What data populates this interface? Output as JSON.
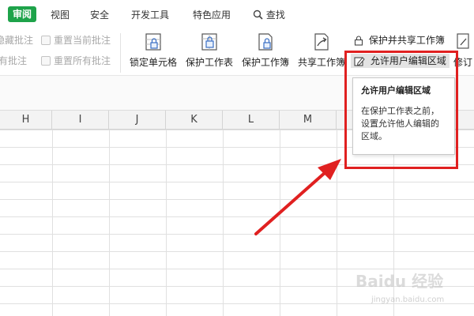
{
  "menu": {
    "tabs": [
      {
        "label": "审阅",
        "active": true
      },
      {
        "label": "视图"
      },
      {
        "label": "安全"
      },
      {
        "label": "开发工具"
      },
      {
        "label": "特色应用"
      }
    ],
    "search_label": "查找"
  },
  "ribbon": {
    "left_items": [
      "隐藏批注",
      "重置当前批注",
      "有批注",
      "重置所有批注"
    ],
    "buttons": [
      "锁定单元格",
      "保护工作表",
      "保护工作簿",
      "共享工作簿"
    ],
    "protect_share_label": "保护并共享工作簿",
    "allow_edit_label": "允许用户编辑区域",
    "revise_label": "修订"
  },
  "columns": [
    "H",
    "I",
    "J",
    "K",
    "L",
    "M"
  ],
  "tooltip": {
    "title": "允许用户编辑区域",
    "body": "在保护工作表之前，设置允许他人编辑的区域。"
  },
  "watermark": {
    "text": "Baidu 经验",
    "url_text": "jingyan.baidu.com"
  },
  "colors": {
    "accent": "#1ea34a",
    "annotation": "#e02020"
  }
}
